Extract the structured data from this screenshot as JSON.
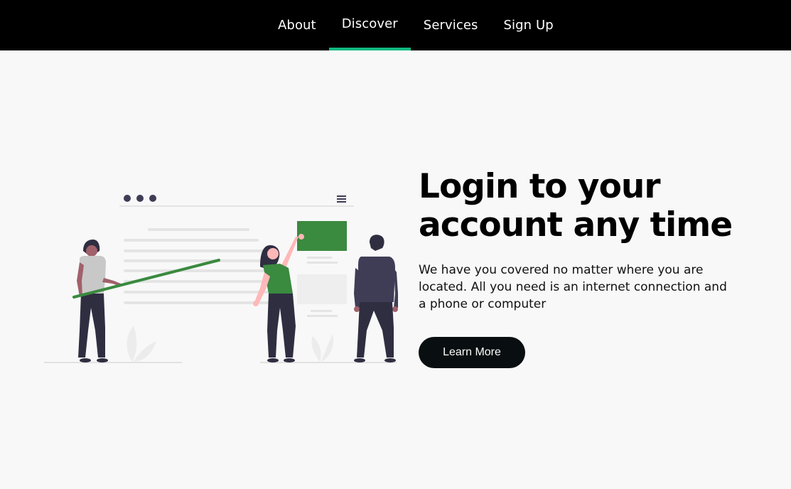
{
  "nav": {
    "items": [
      {
        "label": "About"
      },
      {
        "label": "Discover"
      },
      {
        "label": "Services"
      },
      {
        "label": "Sign Up"
      }
    ],
    "active_index": 1
  },
  "hero": {
    "title_line1": "Login to your",
    "title_line2": "account any time",
    "description": "We have you covered no matter where you are located. All you need is an internet connection and a phone or computer",
    "button_label": "Learn More"
  },
  "colors": {
    "nav_background": "#000000",
    "active_underline": "#10b981",
    "page_background": "#f8f8f8",
    "button_background": "#090e10",
    "illustration_green": "#3a8a3f"
  },
  "illustration": {
    "icon": "team-presentation-illustration"
  }
}
